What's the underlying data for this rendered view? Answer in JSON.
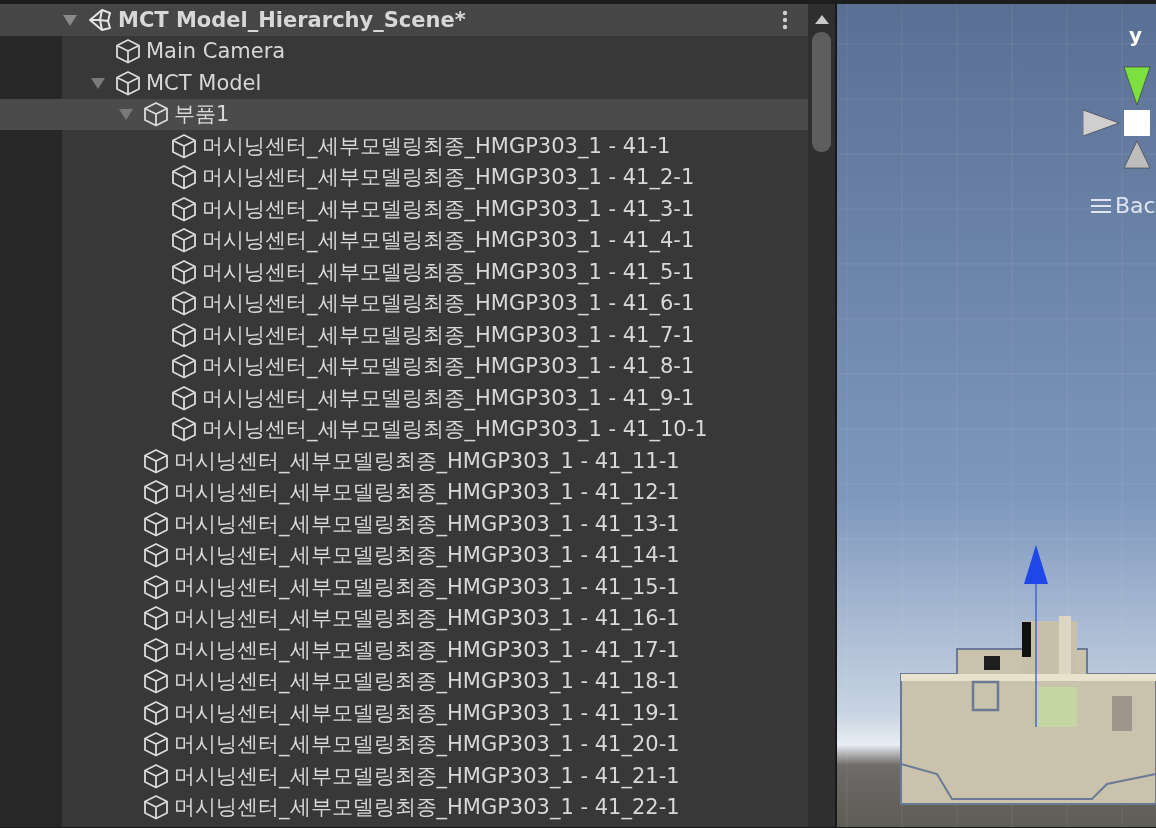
{
  "hierarchy": {
    "scene": {
      "name": "MCT Model_Hierarchy_Scene*",
      "expanded": true
    },
    "items": [
      {
        "name": "Main Camera",
        "selected": false
      },
      {
        "name": "MCT Model",
        "selected": false,
        "expanded": true,
        "children": [
          {
            "name": "부품1",
            "selected": true,
            "expanded": true,
            "children": [
              {
                "name": "머시닝센터_세부모델링최종_HMGP303_1 - 41-1",
                "selected": false
              },
              {
                "name": "머시닝센터_세부모델링최종_HMGP303_1 - 41_2-1",
                "selected": false
              },
              {
                "name": "머시닝센터_세부모델링최종_HMGP303_1 - 41_3-1",
                "selected": false
              },
              {
                "name": "머시닝센터_세부모델링최종_HMGP303_1 - 41_4-1",
                "selected": false
              },
              {
                "name": "머시닝센터_세부모델링최종_HMGP303_1 - 41_5-1",
                "selected": false
              },
              {
                "name": "머시닝센터_세부모델링최종_HMGP303_1 - 41_6-1",
                "selected": false
              },
              {
                "name": "머시닝센터_세부모델링최종_HMGP303_1 - 41_7-1",
                "selected": false
              },
              {
                "name": "머시닝센터_세부모델링최종_HMGP303_1 - 41_8-1",
                "selected": false
              },
              {
                "name": "머시닝센터_세부모델링최종_HMGP303_1 - 41_9-1",
                "selected": false
              },
              {
                "name": "머시닝센터_세부모델링최종_HMGP303_1 - 41_10-1",
                "selected": false
              }
            ]
          },
          {
            "name": "머시닝센터_세부모델링최종_HMGP303_1 - 41_11-1",
            "selected": false
          },
          {
            "name": "머시닝센터_세부모델링최종_HMGP303_1 - 41_12-1",
            "selected": false
          },
          {
            "name": "머시닝센터_세부모델링최종_HMGP303_1 - 41_13-1",
            "selected": false
          },
          {
            "name": "머시닝센터_세부모델링최종_HMGP303_1 - 41_14-1",
            "selected": false
          },
          {
            "name": "머시닝센터_세부모델링최종_HMGP303_1 - 41_15-1",
            "selected": false
          },
          {
            "name": "머시닝센터_세부모델링최종_HMGP303_1 - 41_16-1",
            "selected": false
          },
          {
            "name": "머시닝센터_세부모델링최종_HMGP303_1 - 41_17-1",
            "selected": false
          },
          {
            "name": "머시닝센터_세부모델링최종_HMGP303_1 - 41_18-1",
            "selected": false
          },
          {
            "name": "머시닝센터_세부모델링최종_HMGP303_1 - 41_19-1",
            "selected": false
          },
          {
            "name": "머시닝센터_세부모델링최종_HMGP303_1 - 41_20-1",
            "selected": false
          },
          {
            "name": "머시닝센터_세부모델링최종_HMGP303_1 - 41_21-1",
            "selected": false
          },
          {
            "name": "머시닝센터_세부모델링최종_HMGP303_1 - 41_22-1",
            "selected": false
          }
        ]
      }
    ]
  },
  "scene_view": {
    "gizmo_axis_label": "y",
    "overlay_label": "Bac"
  }
}
